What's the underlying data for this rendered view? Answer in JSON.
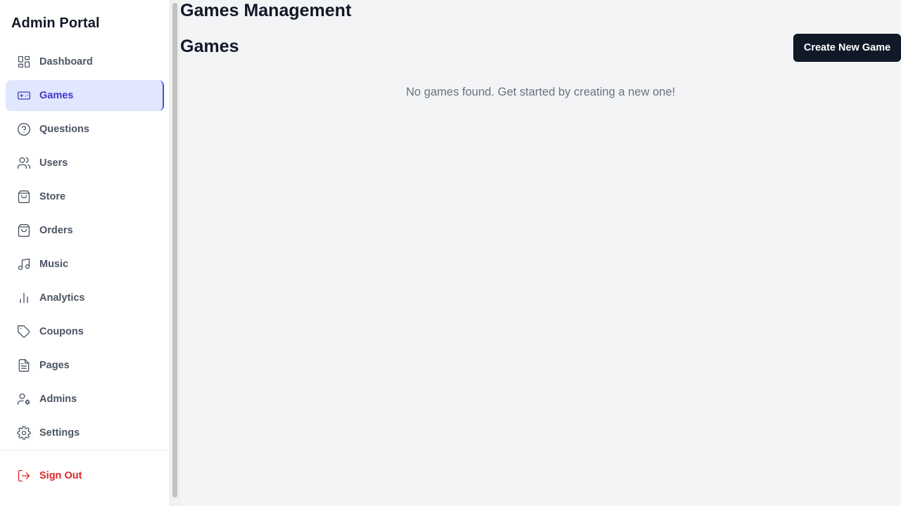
{
  "sidebar": {
    "title": "Admin Portal",
    "items": [
      {
        "label": "Dashboard",
        "icon": "dashboard-icon",
        "active": false
      },
      {
        "label": "Games",
        "icon": "gamepad-icon",
        "active": true
      },
      {
        "label": "Questions",
        "icon": "question-circle-icon",
        "active": false
      },
      {
        "label": "Users",
        "icon": "users-icon",
        "active": false
      },
      {
        "label": "Store",
        "icon": "shopping-bag-icon",
        "active": false
      },
      {
        "label": "Orders",
        "icon": "shopping-bag-icon",
        "active": false
      },
      {
        "label": "Music",
        "icon": "music-icon",
        "active": false
      },
      {
        "label": "Analytics",
        "icon": "bar-chart-icon",
        "active": false
      },
      {
        "label": "Coupons",
        "icon": "tag-icon",
        "active": false
      },
      {
        "label": "Pages",
        "icon": "file-text-icon",
        "active": false
      },
      {
        "label": "Admins",
        "icon": "user-cog-icon",
        "active": false
      },
      {
        "label": "Settings",
        "icon": "gear-icon",
        "active": false
      }
    ],
    "signout_label": "Sign Out",
    "signout_icon": "log-out-icon"
  },
  "main": {
    "page_title": "Games Management",
    "section_title": "Games",
    "create_button_label": "Create New Game",
    "empty_message": "No games found. Get started by creating a new one!"
  },
  "colors": {
    "accent": "#4338ca",
    "active_bg": "#e0e7ff",
    "danger": "#dc2626",
    "button_bg": "#111827"
  }
}
